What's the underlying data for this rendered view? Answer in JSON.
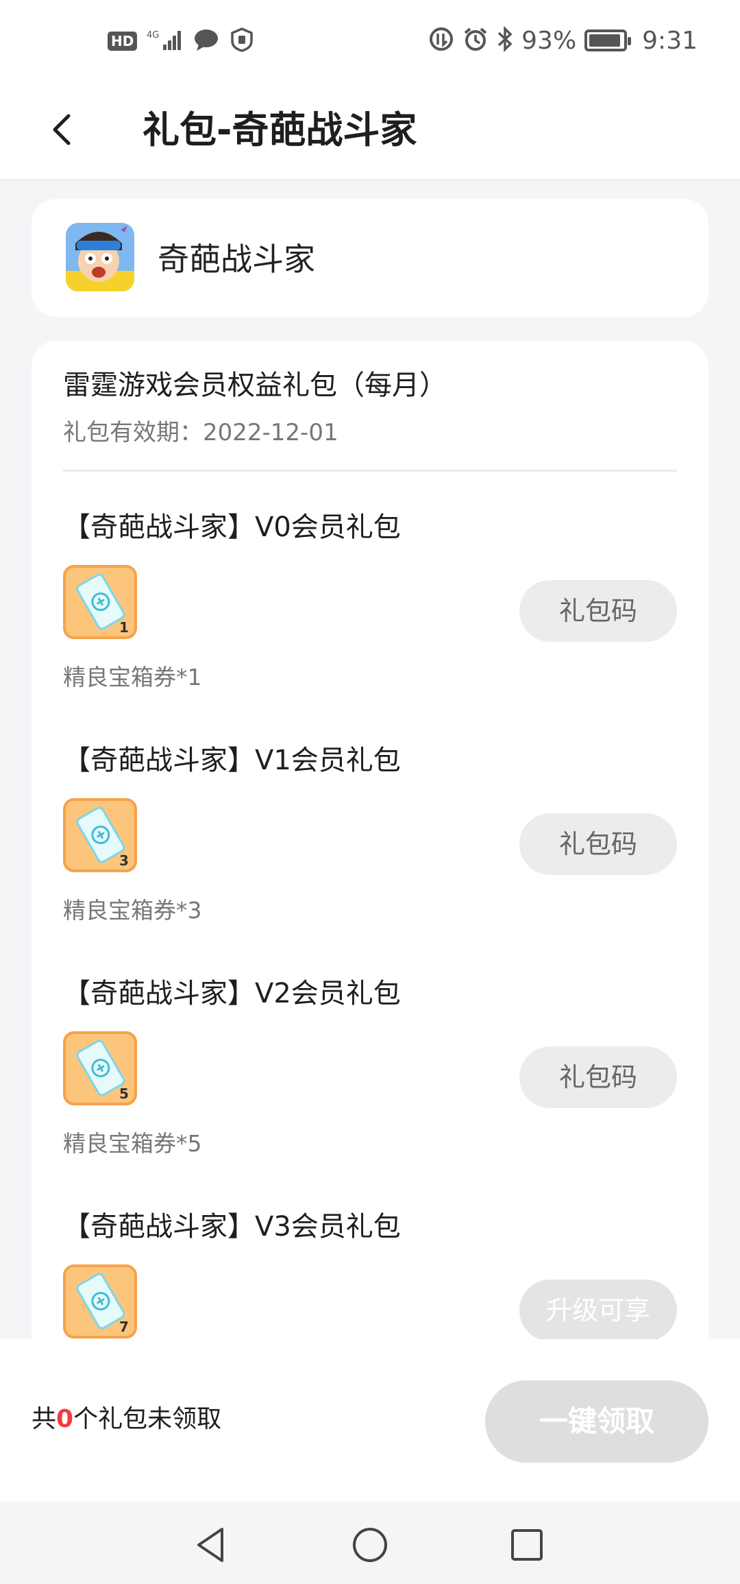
{
  "status_bar": {
    "left_badge": "HD",
    "network": "4G",
    "battery_percent": "93%",
    "battery_level": 0.93,
    "time": "9:31"
  },
  "header": {
    "title": "礼包-奇葩战斗家"
  },
  "game": {
    "name": "奇葩战斗家"
  },
  "gift_group": {
    "title": "雷霆游戏会员权益礼包（每月）",
    "validity": "礼包有效期：2022-12-01",
    "items": [
      {
        "name": "【奇葩战斗家】V0会员礼包",
        "badge": "1",
        "button": "礼包码",
        "desc": "精良宝箱券*1"
      },
      {
        "name": "【奇葩战斗家】V1会员礼包",
        "badge": "3",
        "button": "礼包码",
        "desc": "精良宝箱券*3"
      },
      {
        "name": "【奇葩战斗家】V2会员礼包",
        "badge": "5",
        "button": "礼包码",
        "desc": "精良宝箱券*5"
      },
      {
        "name": "【奇葩战斗家】V3会员礼包",
        "badge": "7",
        "button": "升级可享",
        "desc": ""
      }
    ]
  },
  "bottom_bar": {
    "prefix": "共",
    "count": "0",
    "suffix": "个礼包未领取",
    "claim_all": "一键领取"
  },
  "colors": {
    "accent_red": "#f23c3c",
    "icon_orange": "#fbc57c",
    "icon_border": "#f6a24a"
  }
}
